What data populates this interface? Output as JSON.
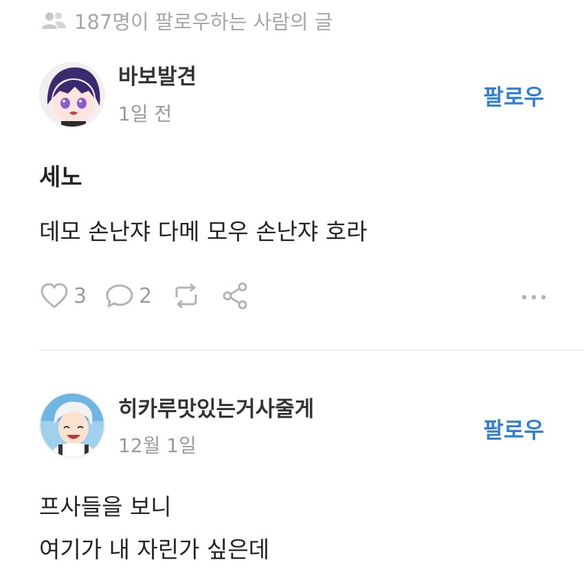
{
  "header": {
    "follower_posts": "187명이 팔로우하는 사람의 글"
  },
  "posts": [
    {
      "author": "바보발견",
      "time": "1일 전",
      "follow_label": "팔로우",
      "title": "세노",
      "body": "데모 손난쟈 다메 모우 손난쟈 호라",
      "likes": "3",
      "comments": "2"
    },
    {
      "author": "히카루맛있는거사줄게",
      "time": "12월 1일",
      "follow_label": "팔로우",
      "lines": [
        "프사들을 보니",
        "여기가 내 자린가 싶은데"
      ]
    }
  ],
  "colors": {
    "accent": "#2f7fd3",
    "muted": "#9a9a9a",
    "icon": "#b3b3b3"
  },
  "icons": [
    "people-icon",
    "heart-icon",
    "comment-icon",
    "repost-icon",
    "share-icon",
    "more-icon"
  ]
}
